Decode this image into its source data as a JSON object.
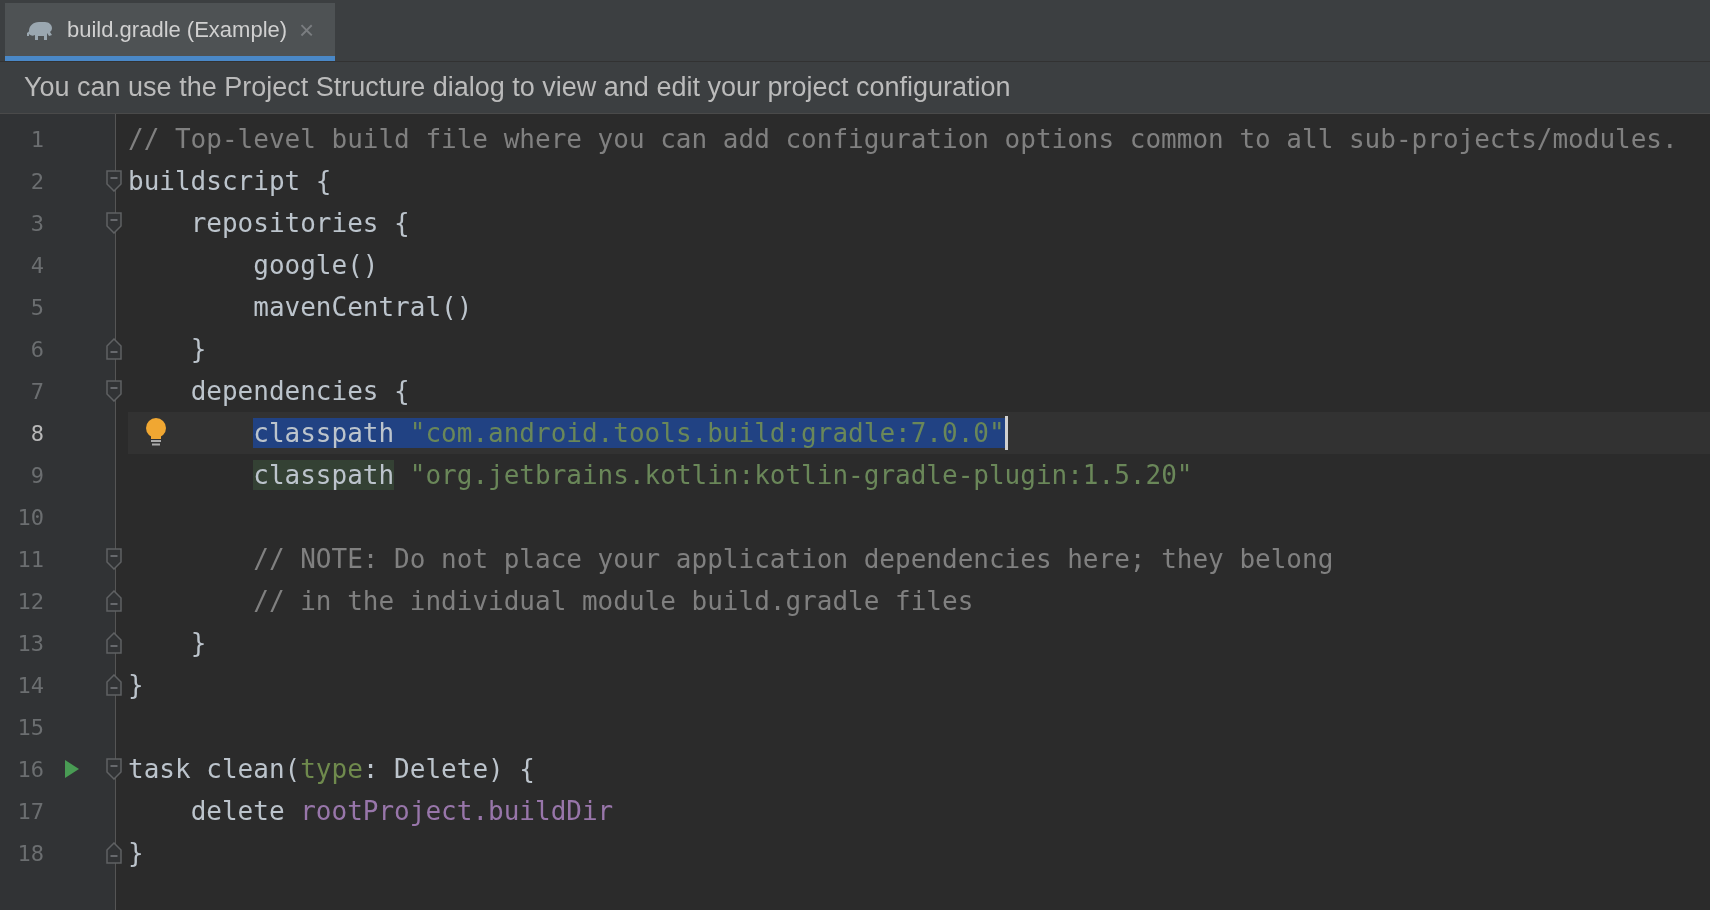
{
  "tabs": [
    {
      "label": "build.gradle (Example)",
      "selected": true,
      "close": "×"
    }
  ],
  "banner": "You can use the Project Structure dialog to view and edit your project configuration",
  "lines": [
    {
      "number": "1",
      "current": false,
      "fold_open": false,
      "fold_close": false,
      "run_marker": false,
      "bulb": false,
      "tokens": [
        {
          "text": "// Top-level build file where you can add configuration options common to all sub-projects/modules.",
          "kind": "comment",
          "selected": false
        }
      ]
    },
    {
      "number": "2",
      "current": false,
      "fold_open": true,
      "fold_close": false,
      "run_marker": false,
      "bulb": false,
      "tokens": [
        {
          "text": "buildscript {",
          "kind": "plain",
          "selected": false
        }
      ]
    },
    {
      "number": "3",
      "current": false,
      "fold_open": true,
      "fold_close": false,
      "run_marker": false,
      "bulb": false,
      "tokens": [
        {
          "text": "    repositories {",
          "kind": "plain",
          "selected": false
        }
      ]
    },
    {
      "number": "4",
      "current": false,
      "fold_open": false,
      "fold_close": false,
      "run_marker": false,
      "bulb": false,
      "tokens": [
        {
          "text": "        google()",
          "kind": "plain",
          "selected": false
        }
      ]
    },
    {
      "number": "5",
      "current": false,
      "fold_open": false,
      "fold_close": false,
      "run_marker": false,
      "bulb": false,
      "tokens": [
        {
          "text": "        mavenCentral()",
          "kind": "plain",
          "selected": false
        }
      ]
    },
    {
      "number": "6",
      "current": false,
      "fold_open": false,
      "fold_close": true,
      "run_marker": false,
      "bulb": false,
      "tokens": [
        {
          "text": "    }",
          "kind": "plain",
          "selected": false
        }
      ]
    },
    {
      "number": "7",
      "current": false,
      "fold_open": true,
      "fold_close": false,
      "run_marker": false,
      "bulb": false,
      "tokens": [
        {
          "text": "    dependencies {",
          "kind": "plain",
          "selected": false
        }
      ]
    },
    {
      "number": "8",
      "current": true,
      "fold_open": false,
      "fold_close": false,
      "run_marker": false,
      "bulb": true,
      "tokens": [
        {
          "text": "        classpath ",
          "kind": "plain",
          "selected": true
        },
        {
          "text": "\"com.android.tools.build:gradle:7.0.0\"",
          "kind": "string",
          "selected": true
        }
      ]
    },
    {
      "number": "9",
      "current": false,
      "fold_open": false,
      "fold_close": false,
      "run_marker": false,
      "bulb": false,
      "tokens": [
        {
          "text": "        classpath",
          "kind": "occurrence",
          "selected": false
        },
        {
          "text": " \"org.jetbrains.kotlin:kotlin-gradle-plugin:1.5.20\"",
          "kind": "string",
          "selected": false
        }
      ]
    },
    {
      "number": "10",
      "current": false,
      "fold_open": false,
      "fold_close": false,
      "run_marker": false,
      "bulb": false
    },
    {
      "number": "11",
      "current": false,
      "fold_open": true,
      "fold_close": false,
      "run_marker": false,
      "bulb": false,
      "tokens": [
        {
          "text": "        // NOTE: Do not place your application dependencies here; they belong",
          "kind": "comment",
          "selected": false
        }
      ]
    },
    {
      "number": "12",
      "current": false,
      "fold_open": false,
      "fold_close": true,
      "run_marker": false,
      "bulb": false,
      "tokens": [
        {
          "text": "        // in the individual module build.gradle files",
          "kind": "comment",
          "selected": false
        }
      ]
    },
    {
      "number": "13",
      "current": false,
      "fold_open": false,
      "fold_close": true,
      "run_marker": false,
      "bulb": false,
      "tokens": [
        {
          "text": "    }",
          "kind": "plain",
          "selected": false
        }
      ]
    },
    {
      "number": "14",
      "current": false,
      "fold_open": false,
      "fold_close": true,
      "run_marker": false,
      "bulb": false,
      "tokens": [
        {
          "text": "}",
          "kind": "plain",
          "selected": false
        }
      ]
    },
    {
      "number": "15",
      "current": false,
      "fold_open": false,
      "fold_close": false,
      "run_marker": false,
      "bulb": false
    },
    {
      "number": "16",
      "current": false,
      "fold_open": true,
      "fold_close": false,
      "run_marker": true,
      "bulb": false,
      "tokens": [
        {
          "text": "task clean(",
          "kind": "plain",
          "selected": false
        },
        {
          "text": "type",
          "kind": "param",
          "selected": false
        },
        {
          "text": ": Delete) {",
          "kind": "plain",
          "selected": false
        }
      ]
    },
    {
      "number": "17",
      "current": false,
      "fold_open": false,
      "fold_close": false,
      "run_marker": false,
      "bulb": false,
      "tokens": [
        {
          "text": "    delete ",
          "kind": "plain",
          "selected": false
        },
        {
          "text": "rootProject.buildDir",
          "kind": "property",
          "selected": false
        }
      ]
    },
    {
      "number": "18",
      "current": false,
      "fold_open": false,
      "fold_close": true,
      "run_marker": false,
      "bulb": false,
      "tokens": [
        {
          "text": "}",
          "kind": "plain",
          "selected": false
        }
      ]
    }
  ]
}
